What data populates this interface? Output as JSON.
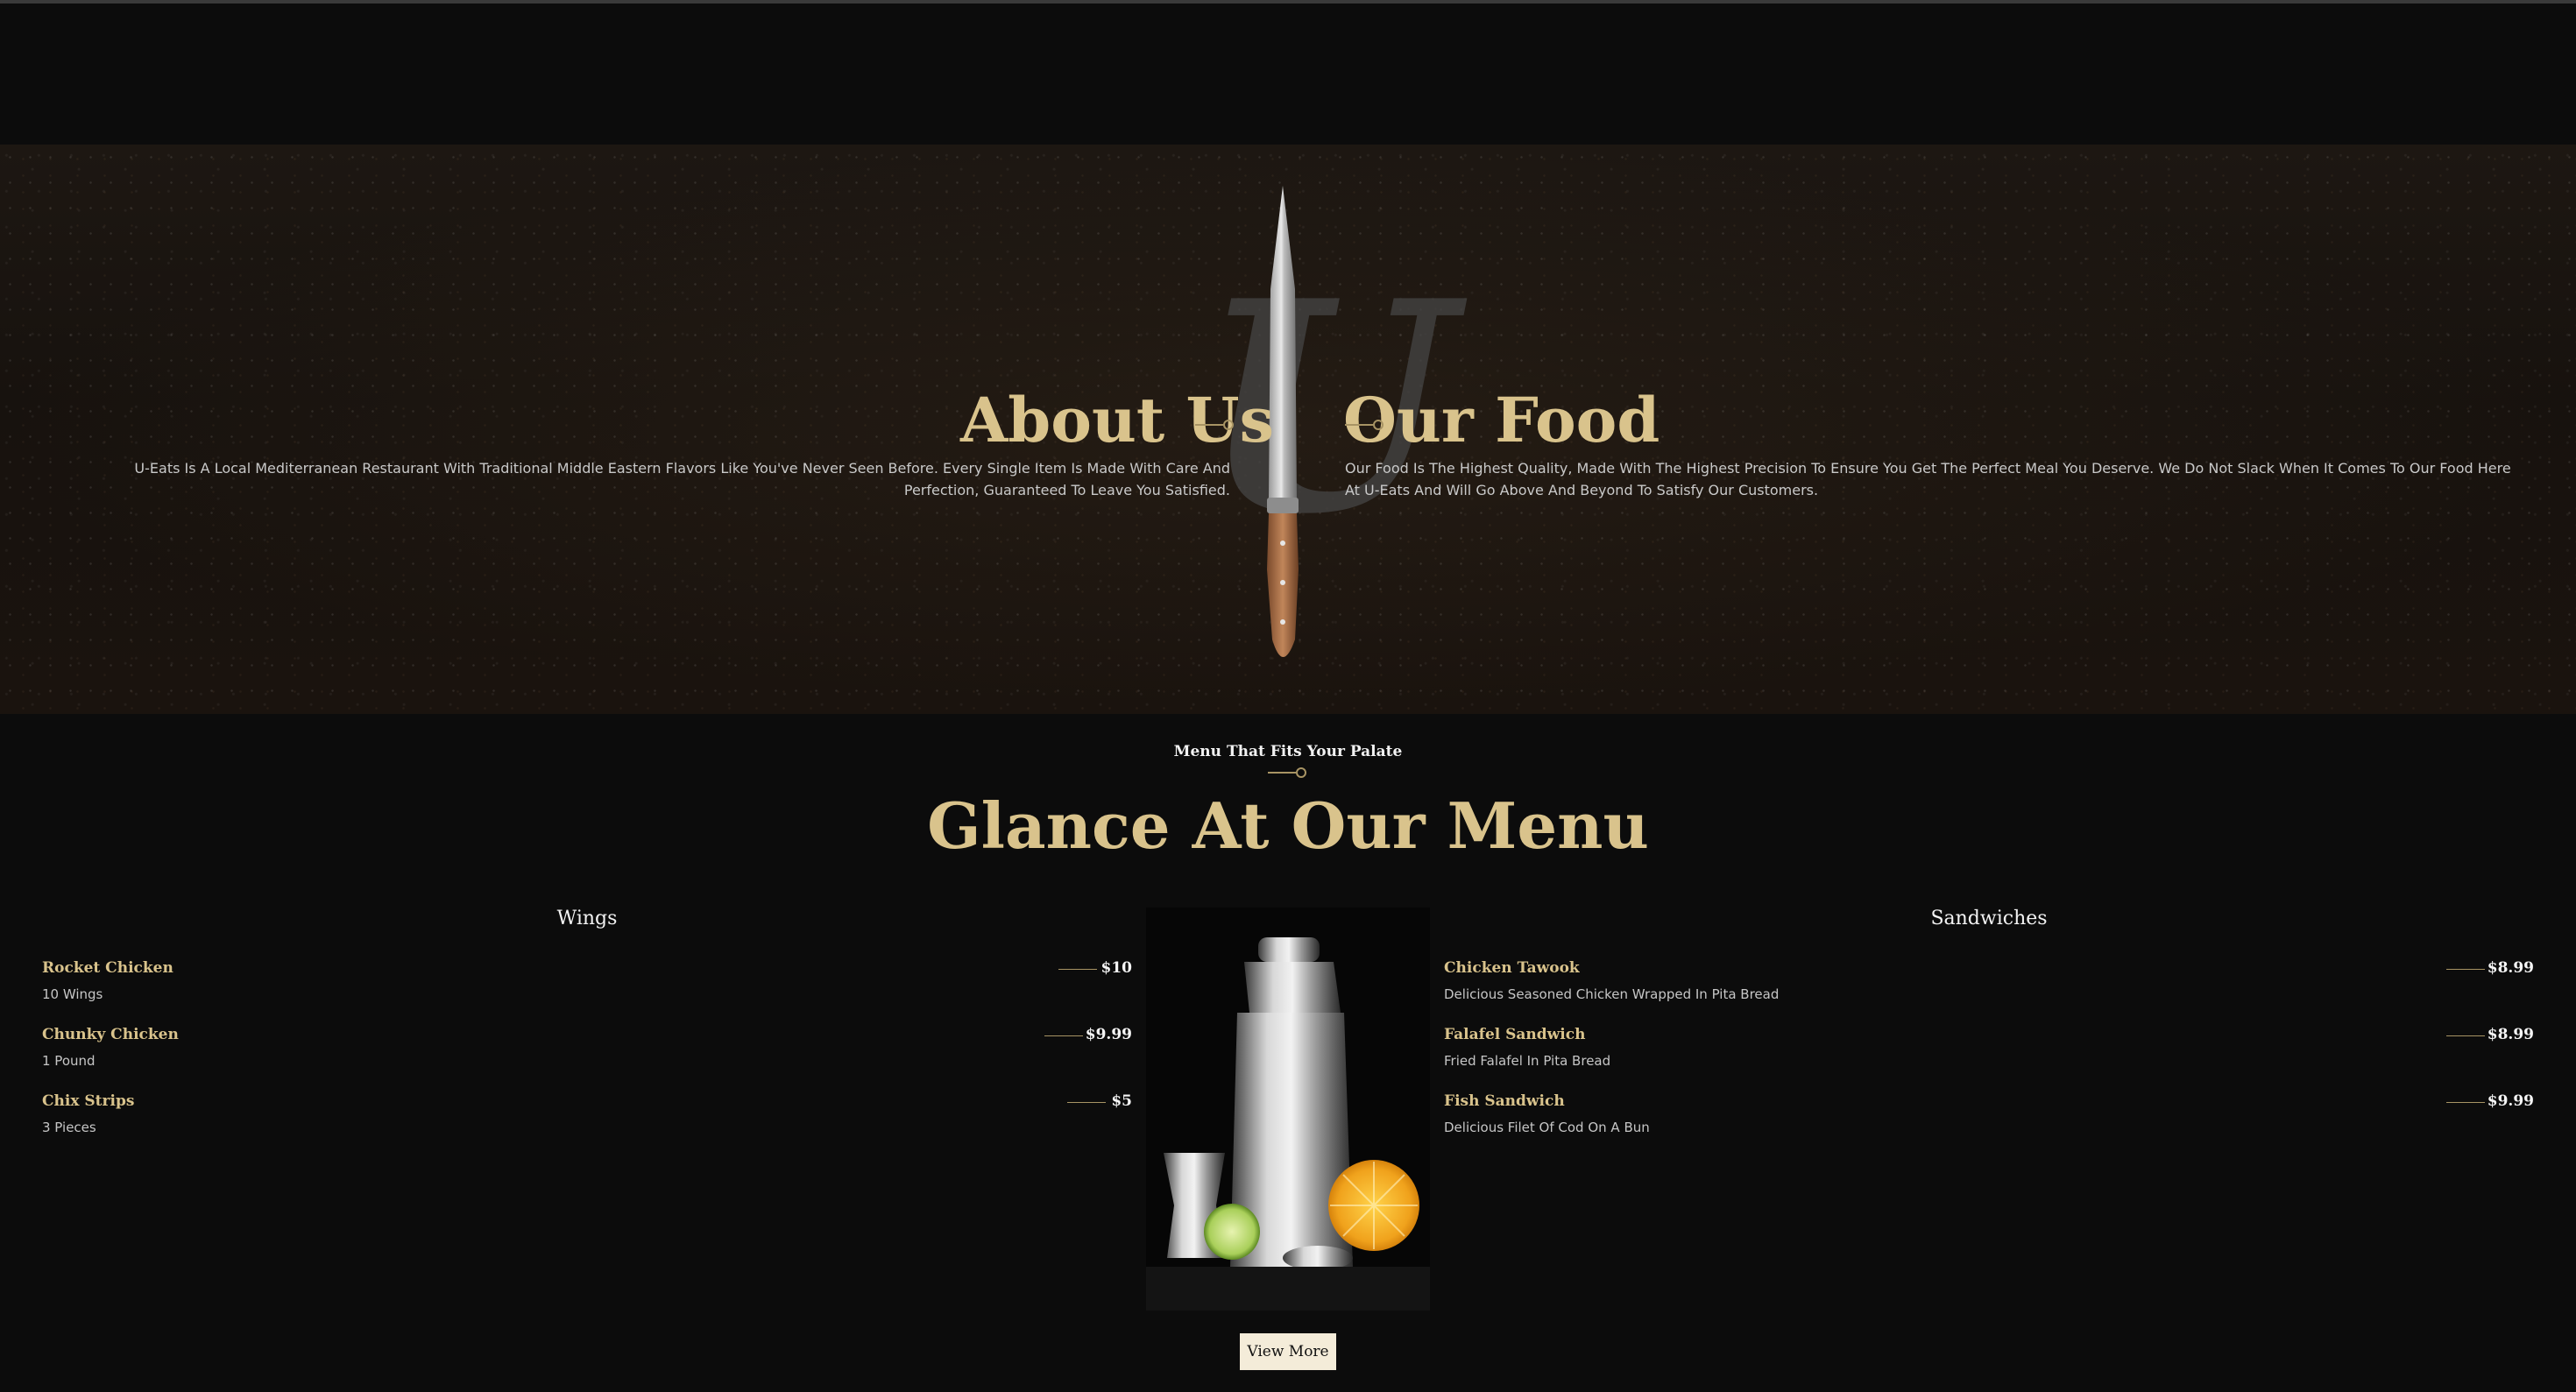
{
  "about": {
    "heading": "About Us",
    "text": "U-Eats Is A Local Mediterranean Restaurant With Traditional Middle Eastern Flavors Like You've Never Seen Before. Every Single Item Is Made With Care And Perfection, Guaranteed To Leave You Satisfied."
  },
  "food": {
    "heading": "Our Food",
    "text": "Our Food Is The Highest Quality, Made With The Highest Precision To Ensure You Get The Perfect Meal You Deserve. We Do Not Slack When It Comes To Our Food Here At U-Eats And Will Go Above And Beyond To Satisfy Our Customers."
  },
  "brand_letter": "U",
  "menu": {
    "kicker": "Menu That Fits Your Palate",
    "title": "Glance At Our Menu",
    "view_more": "View More",
    "columns": [
      {
        "title": "Wings",
        "items": [
          {
            "name": "Rocket Chicken",
            "desc": "10 Wings",
            "price": "$10"
          },
          {
            "name": "Chunky Chicken",
            "desc": "1 Pound",
            "price": "$9.99"
          },
          {
            "name": "Chix Strips",
            "desc": "3 Pieces",
            "price": "$5"
          }
        ]
      },
      {
        "title": "Sandwiches",
        "items": [
          {
            "name": "Chicken Tawook",
            "desc": "Delicious Seasoned Chicken Wrapped In Pita Bread",
            "price": "$8.99"
          },
          {
            "name": "Falafel Sandwich",
            "desc": "Fried Falafel In Pita Bread",
            "price": "$8.99"
          },
          {
            "name": "Fish Sandwich",
            "desc": "Delicious Filet Of Cod On A Bun",
            "price": "$9.99"
          }
        ]
      }
    ]
  },
  "colors": {
    "gold": "#d9c38c",
    "background": "#0c0c0c",
    "button_bg": "#f4ecd9"
  }
}
